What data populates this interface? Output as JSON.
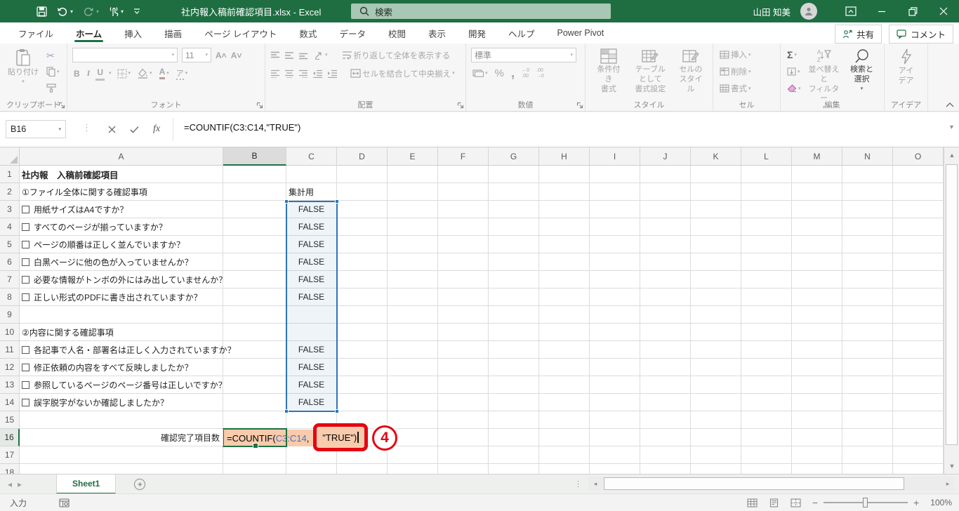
{
  "window": {
    "title": "社内報入稿前確認項目.xlsx - Excel",
    "search_placeholder": "検索",
    "user_name": "山田 知美"
  },
  "ribbon": {
    "tabs": [
      "ファイル",
      "ホーム",
      "挿入",
      "描画",
      "ページ レイアウト",
      "数式",
      "データ",
      "校閲",
      "表示",
      "開発",
      "ヘルプ",
      "Power Pivot"
    ],
    "active_tab": "ホーム",
    "share_label": "共有",
    "comments_label": "コメント",
    "groups": {
      "clipboard": {
        "label": "クリップボード",
        "paste": "貼り付け"
      },
      "font": {
        "label": "フォント",
        "size": "11"
      },
      "alignment": {
        "label": "配置",
        "wrap": "折り返して全体を表示する",
        "merge": "セルを結合して中央揃え"
      },
      "number": {
        "label": "数値",
        "format": "標準"
      },
      "styles": {
        "label": "スタイル",
        "conditional": "条件付き\n書式",
        "table": "テーブルとして\n書式設定",
        "cell": "セルの\nスタイル"
      },
      "cells": {
        "label": "セル",
        "insert": "挿入",
        "delete": "削除",
        "format": "書式"
      },
      "editing": {
        "label": "編集",
        "sort": "並べ替えと\nフィルター",
        "find": "検索と\n選択"
      },
      "ideas": {
        "label": "アイデア",
        "button": "アイ\nデア"
      }
    }
  },
  "formula_bar": {
    "name_box": "B16",
    "formula": "=COUNTIF(C3:C14,\"TRUE\")"
  },
  "sheet": {
    "columns": [
      "A",
      "B",
      "C",
      "D",
      "E",
      "F",
      "G",
      "H",
      "I",
      "J",
      "K",
      "L",
      "M",
      "N",
      "O"
    ],
    "active_column": "B",
    "active_row": 16,
    "highlight_range": "C3:C14",
    "rows": [
      {
        "n": 1,
        "a": "社内報　入稿前確認項目",
        "bold": true
      },
      {
        "n": 2,
        "a": "①ファイル全体に関する確認事項",
        "c": "集計用",
        "c_align": "left"
      },
      {
        "n": 3,
        "a": "用紙サイズはA4ですか？",
        "checkbox": true,
        "c": "FALSE"
      },
      {
        "n": 4,
        "a": "すべてのページが揃っていますか？",
        "checkbox": true,
        "c": "FALSE"
      },
      {
        "n": 5,
        "a": "ページの順番は正しく並んでいますか？",
        "checkbox": true,
        "c": "FALSE"
      },
      {
        "n": 6,
        "a": "白黒ページに他の色が入っていませんか？",
        "checkbox": true,
        "c": "FALSE"
      },
      {
        "n": 7,
        "a": "必要な情報がトンボの外にはみ出していませんか？",
        "checkbox": true,
        "c": "FALSE"
      },
      {
        "n": 8,
        "a": "正しい形式のPDFに書き出されていますか？",
        "checkbox": true,
        "c": "FALSE"
      },
      {
        "n": 9
      },
      {
        "n": 10,
        "a": "②内容に関する確認事項"
      },
      {
        "n": 11,
        "a": "各記事で人名・部署名は正しく入力されていますか？",
        "checkbox": true,
        "c": "FALSE"
      },
      {
        "n": 12,
        "a": "修正依頼の内容をすべて反映しましたか？",
        "checkbox": true,
        "c": "FALSE"
      },
      {
        "n": 13,
        "a": "参照しているページのページ番号は正しいですか？",
        "checkbox": true,
        "c": "FALSE"
      },
      {
        "n": 14,
        "a": "誤字脱字がないか確認しましたか？",
        "checkbox": true,
        "c": "FALSE"
      },
      {
        "n": 15
      },
      {
        "n": 16,
        "a": "確認完了項目数",
        "a_align": "right"
      },
      {
        "n": 17
      },
      {
        "n": 18
      }
    ],
    "edit_cell": {
      "address": "B16",
      "prefix": "=COUNTIF(",
      "reference": "C3:C14",
      "separator": ",",
      "highlighted": "\"TRUE\")"
    }
  },
  "annotation": {
    "step": "4"
  },
  "sheet_tabs": {
    "active": "Sheet1"
  },
  "status_bar": {
    "mode": "入力",
    "zoom": "100%"
  },
  "colors": {
    "excel_green": "#1E6E42",
    "accent_green": "#1E7145",
    "search_box": "#A8C7B4",
    "edit_fill": "#F8CBAD",
    "reference_blue": "#4472C4",
    "range_border": "#2E75B6",
    "annotation_red": "#E30613"
  }
}
